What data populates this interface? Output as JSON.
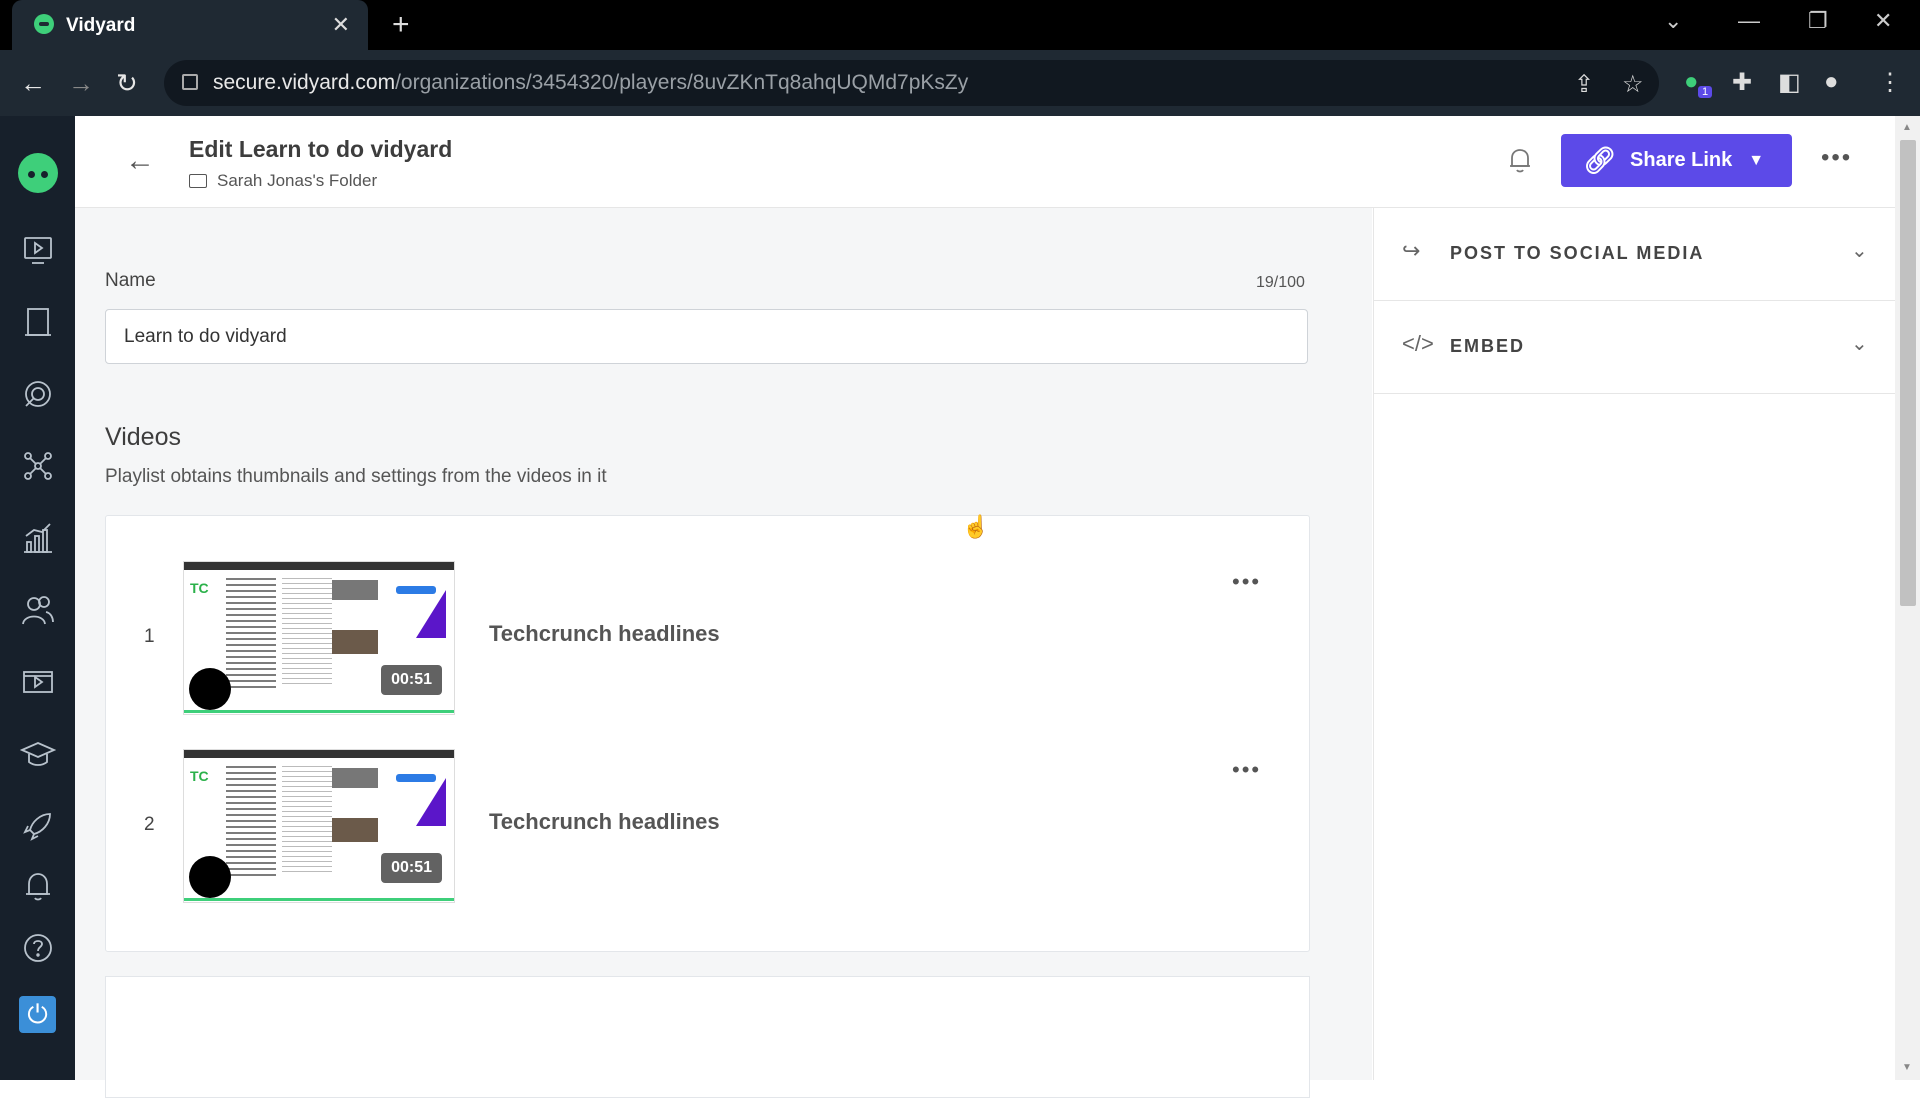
{
  "browser": {
    "tab_title": "Vidyard",
    "url_host": "secure.vidyard.com",
    "url_path": "/organizations/3454320/players/8uvZKnTq8ahqUQMd7pKsZy",
    "extension_badge": "1"
  },
  "header": {
    "title": "Edit Learn to do vidyard",
    "folder": "Sarah Jonas's Folder",
    "share_label": "Share Link"
  },
  "form": {
    "name_label": "Name",
    "name_count": "19/100",
    "name_value": "Learn to do vidyard"
  },
  "videos": {
    "heading": "Videos",
    "subtitle": "Playlist obtains thumbnails and settings from the videos in it",
    "items": [
      {
        "index": "1",
        "title": "Techcrunch headlines",
        "duration": "00:51"
      },
      {
        "index": "2",
        "title": "Techcrunch headlines",
        "duration": "00:51"
      }
    ]
  },
  "right_panel": {
    "sections": [
      {
        "label": "POST TO SOCIAL MEDIA",
        "icon": "share-arrow-icon"
      },
      {
        "label": "EMBED",
        "icon": "code-icon"
      }
    ]
  },
  "colors": {
    "accent": "#5c4ae8",
    "sidebar": "#17202b",
    "brand_green": "#3ecf7a"
  }
}
